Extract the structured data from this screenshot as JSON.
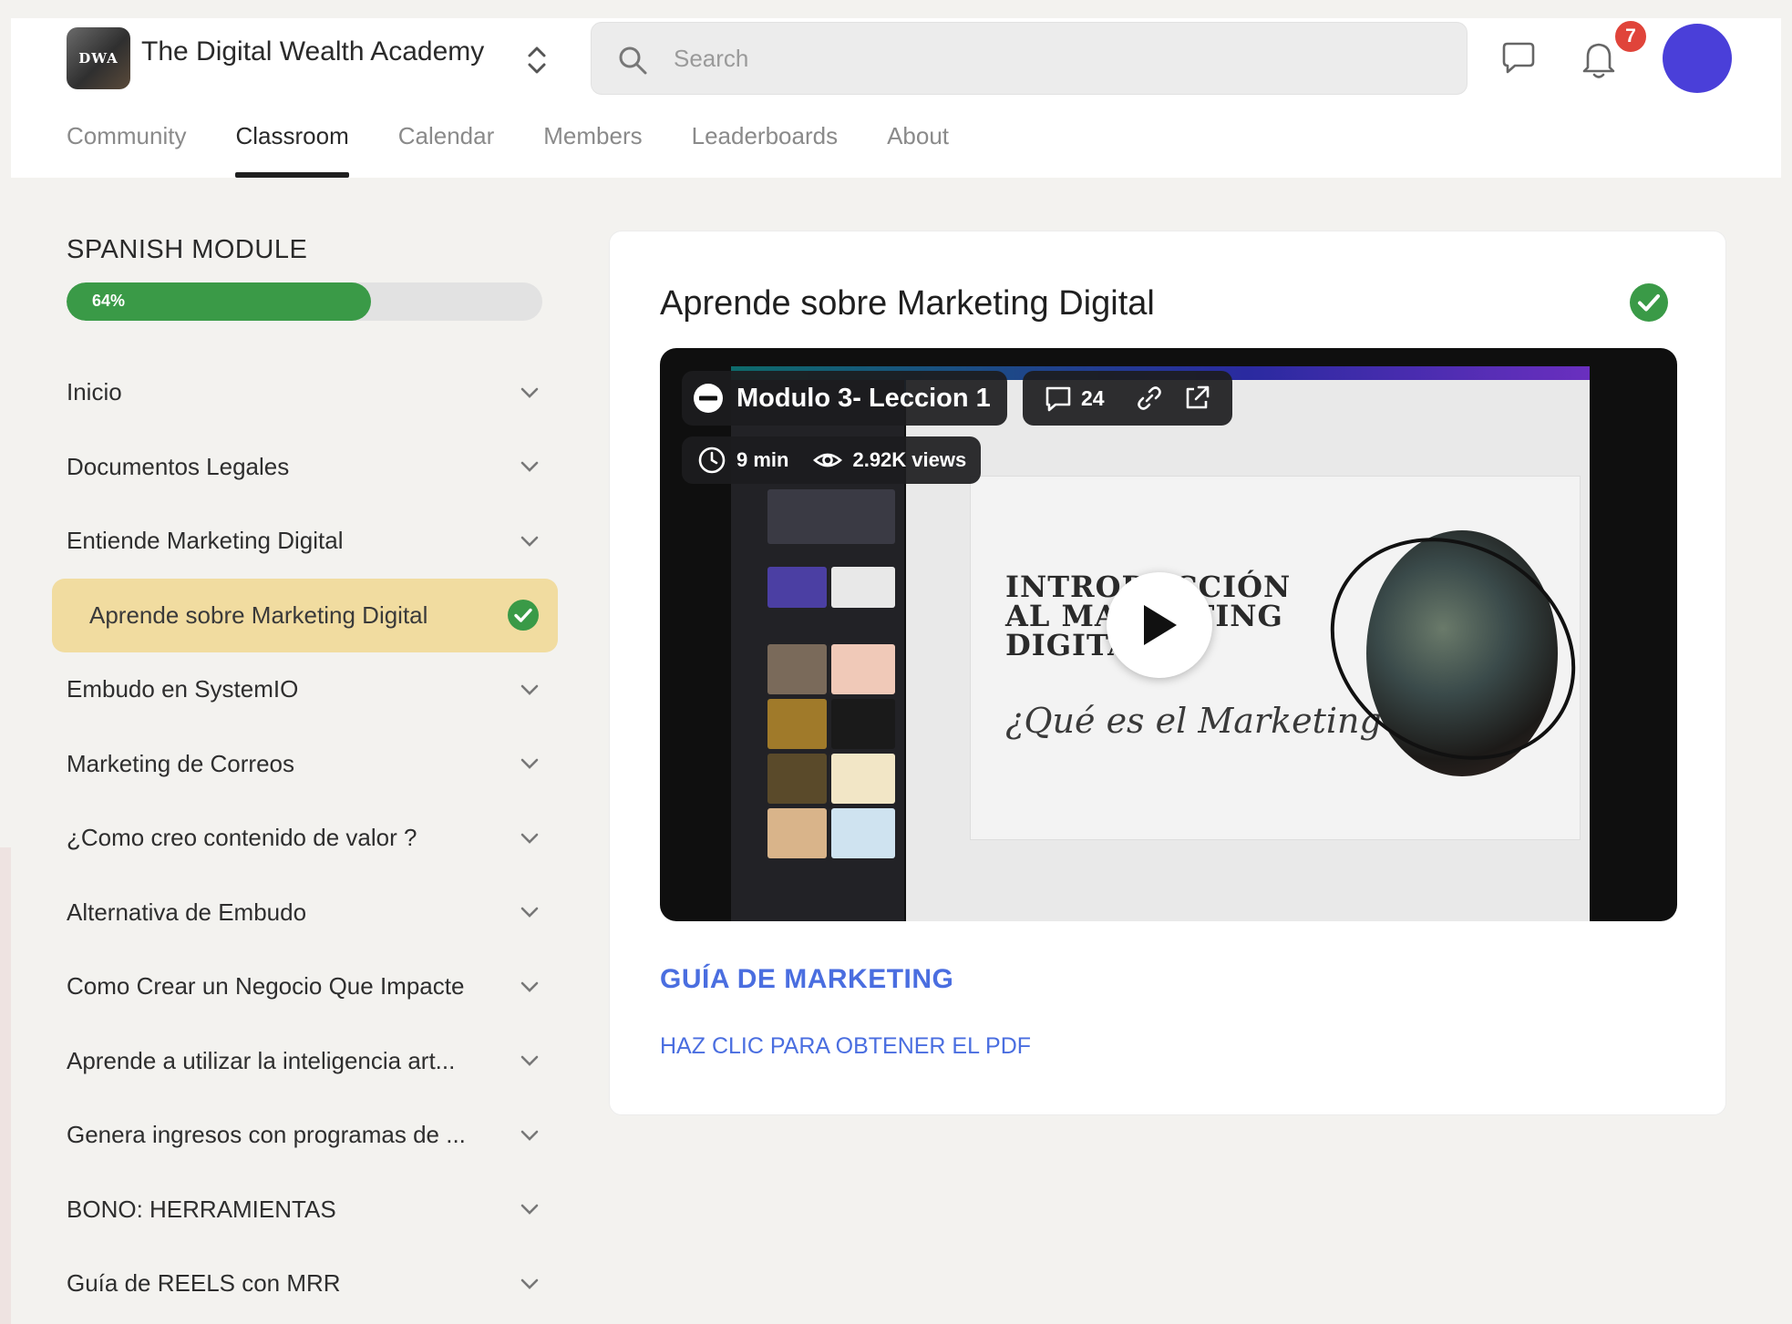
{
  "brand": {
    "logo_text": "DWA",
    "name": "The Digital Wealth Academy"
  },
  "search": {
    "placeholder": "Search"
  },
  "notifications": {
    "count": "7"
  },
  "nav": {
    "tabs": [
      {
        "label": "Community",
        "active": false
      },
      {
        "label": "Classroom",
        "active": true
      },
      {
        "label": "Calendar",
        "active": false
      },
      {
        "label": "Members",
        "active": false
      },
      {
        "label": "Leaderboards",
        "active": false
      },
      {
        "label": "About",
        "active": false
      }
    ]
  },
  "sidebar": {
    "module_title": "SPANISH MODULE",
    "progress": {
      "label": "64%",
      "fraction": 0.64
    },
    "items": [
      {
        "label": "Inicio"
      },
      {
        "label": "Documentos Legales"
      },
      {
        "label": "Entiende Marketing Digital"
      },
      {
        "label": "Aprende sobre Marketing Digital"
      },
      {
        "label": "Embudo en SystemIO"
      },
      {
        "label": "Marketing de Correos"
      },
      {
        "label": "¿Como creo contenido de valor ?"
      },
      {
        "label": "Alternativa de Embudo"
      },
      {
        "label": "Como Crear un Negocio Que Impacte"
      },
      {
        "label": "Aprende a utilizar la inteligencia art..."
      },
      {
        "label": "Genera ingresos con programas de ..."
      },
      {
        "label": "BONO: HERRAMIENTAS"
      },
      {
        "label": "Guía de REELS con MRR"
      }
    ]
  },
  "lesson": {
    "title": "Aprende sobre Marketing Digital",
    "video": {
      "title": "Modulo 3- Leccion 1",
      "comments": "24",
      "duration": "9 min",
      "views": "2.92K views",
      "slide_heading_l1": "INTRODUCCIÓN",
      "slide_heading_l2": "AL MARKETING",
      "slide_heading_l3": "DIGITAL",
      "slide_question": "¿Qué es el Marketing Digital?"
    },
    "guide_title": "GUÍA DE MARKETING",
    "guide_link": "HAZ CLIC PARA OBTENER EL PDF"
  },
  "colors": {
    "progress_green": "#3a9a47",
    "active_item_bg": "#f1dca0",
    "link_blue": "#4a6ee0",
    "avatar": "#4a3fd9",
    "badge_red": "#e0443a"
  }
}
